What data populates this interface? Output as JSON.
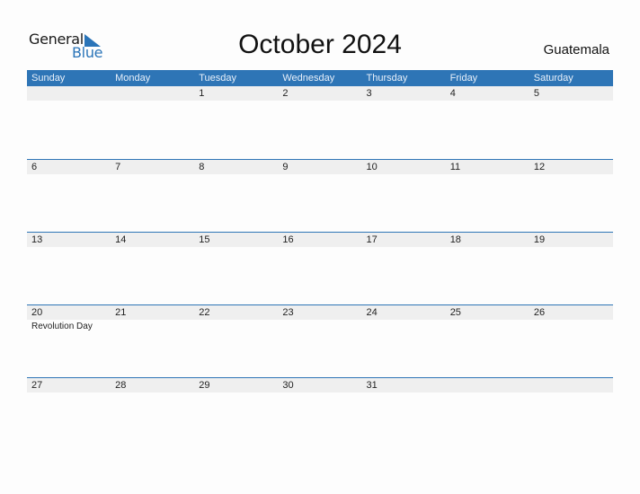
{
  "logo": {
    "text_top": "General",
    "text_bottom": "Blue",
    "accent": "#2e75b6"
  },
  "title": "October 2024",
  "country": "Guatemala",
  "weekdays": [
    "Sunday",
    "Monday",
    "Tuesday",
    "Wednesday",
    "Thursday",
    "Friday",
    "Saturday"
  ],
  "weeks": [
    [
      {
        "day": ""
      },
      {
        "day": ""
      },
      {
        "day": "1"
      },
      {
        "day": "2"
      },
      {
        "day": "3"
      },
      {
        "day": "4"
      },
      {
        "day": "5"
      }
    ],
    [
      {
        "day": "6"
      },
      {
        "day": "7"
      },
      {
        "day": "8"
      },
      {
        "day": "9"
      },
      {
        "day": "10"
      },
      {
        "day": "11"
      },
      {
        "day": "12"
      }
    ],
    [
      {
        "day": "13"
      },
      {
        "day": "14"
      },
      {
        "day": "15"
      },
      {
        "day": "16"
      },
      {
        "day": "17"
      },
      {
        "day": "18"
      },
      {
        "day": "19"
      }
    ],
    [
      {
        "day": "20",
        "event": "Revolution Day"
      },
      {
        "day": "21"
      },
      {
        "day": "22"
      },
      {
        "day": "23"
      },
      {
        "day": "24"
      },
      {
        "day": "25"
      },
      {
        "day": "26"
      }
    ],
    [
      {
        "day": "27"
      },
      {
        "day": "28"
      },
      {
        "day": "29"
      },
      {
        "day": "30"
      },
      {
        "day": "31"
      },
      {
        "day": ""
      },
      {
        "day": ""
      }
    ]
  ]
}
